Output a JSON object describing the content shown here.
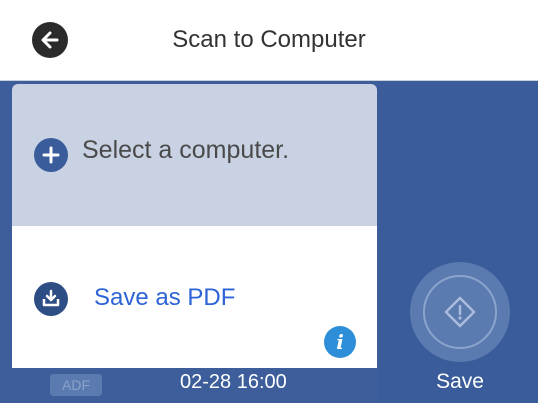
{
  "header": {
    "title": "Scan to Computer",
    "back_icon": "back-arrow-icon"
  },
  "destinations": [
    {
      "label": "Select a computer.",
      "icon": "plus-icon"
    },
    {
      "label": "Save as PDF",
      "icon": "save-tray-icon",
      "info_icon": "info-icon"
    }
  ],
  "status": {
    "adf": "ADF",
    "datetime": "02-28 16:00"
  },
  "action": {
    "start_label": "Save",
    "start_icon": "start-diamond-icon"
  },
  "colors": {
    "panel_blue": "#3d5e9a",
    "selected_card": "#c8d2e2",
    "link_blue": "#2c63d6",
    "info_blue": "#2e8fd8"
  }
}
